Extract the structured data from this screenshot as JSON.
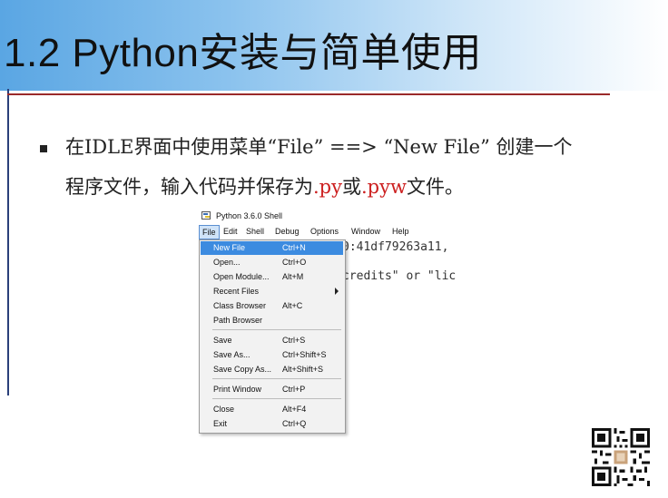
{
  "slide": {
    "title": "1.2 Python安装与简单使用",
    "bullet": {
      "line1": "在IDLE界面中使用菜单“File” ==> “New File” 创建一个",
      "line2_a": "程序文件，输入代码并保存为",
      "line2_py": ".py",
      "line2_or": "或",
      "line2_pyw": ".pyw",
      "line2_b": "文件。"
    },
    "accent_color": "#cc1f1f"
  },
  "shell": {
    "window_title": "Python 3.6.0 Shell",
    "menubar": [
      "File",
      "Edit",
      "Shell",
      "Debug",
      "Options",
      "Window",
      "Help"
    ],
    "console_line1": "0:41df79263a11,",
    "console_line2": "credits\" or \"lic",
    "file_menu": [
      {
        "label": "New File",
        "shortcut": "Ctrl+N",
        "highlighted": true
      },
      {
        "label": "Open...",
        "shortcut": "Ctrl+O"
      },
      {
        "label": "Open Module...",
        "shortcut": "Alt+M"
      },
      {
        "label": "Recent Files",
        "shortcut": "",
        "submenu": true
      },
      {
        "label": "Class Browser",
        "shortcut": "Alt+C"
      },
      {
        "label": "Path Browser",
        "shortcut": ""
      },
      {
        "label": "Save",
        "shortcut": "Ctrl+S"
      },
      {
        "label": "Save As...",
        "shortcut": "Ctrl+Shift+S"
      },
      {
        "label": "Save Copy As...",
        "shortcut": "Alt+Shift+S"
      },
      {
        "label": "Print Window",
        "shortcut": "Ctrl+P"
      },
      {
        "label": "Close",
        "shortcut": "Alt+F4"
      },
      {
        "label": "Exit",
        "shortcut": "Ctrl+Q"
      }
    ],
    "highlight_color": "#3c8be0"
  },
  "icons": {
    "shell_icon": "python-shell-icon",
    "submenu_icon": "chevron-right-icon",
    "qr_icon": "qr-code-icon"
  }
}
